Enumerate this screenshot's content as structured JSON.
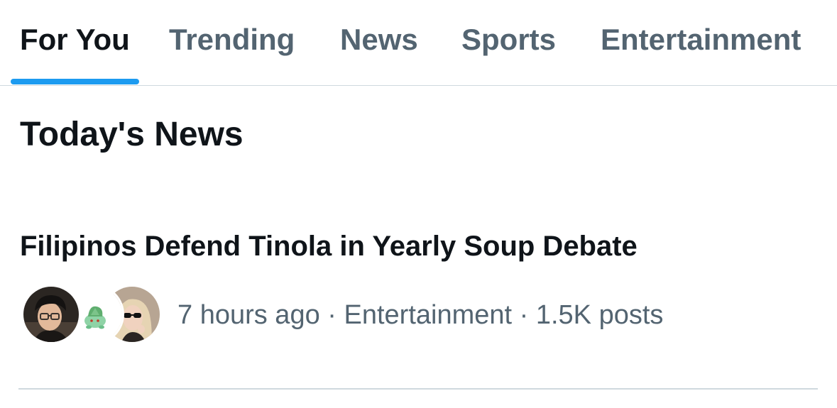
{
  "tabs": [
    {
      "label": "For You",
      "active": true
    },
    {
      "label": "Trending",
      "active": false
    },
    {
      "label": "News",
      "active": false
    },
    {
      "label": "Sports",
      "active": false
    },
    {
      "label": "Entertainment",
      "active": false
    }
  ],
  "colors": {
    "accent": "#1d9bf0",
    "primary_text": "#0f1419",
    "secondary_text": "#536471",
    "divider": "#cfd9de"
  },
  "section": {
    "title": "Today's News"
  },
  "news": [
    {
      "headline": "Filipinos Defend Tinola in Yearly Soup Debate",
      "time": "7 hours ago",
      "separator": "·",
      "category": "Entertainment",
      "posts": "1.5K posts",
      "avatars": [
        "user-avatar-photo",
        "plant-sprite-avatar",
        "user-avatar-sunglasses"
      ]
    }
  ]
}
